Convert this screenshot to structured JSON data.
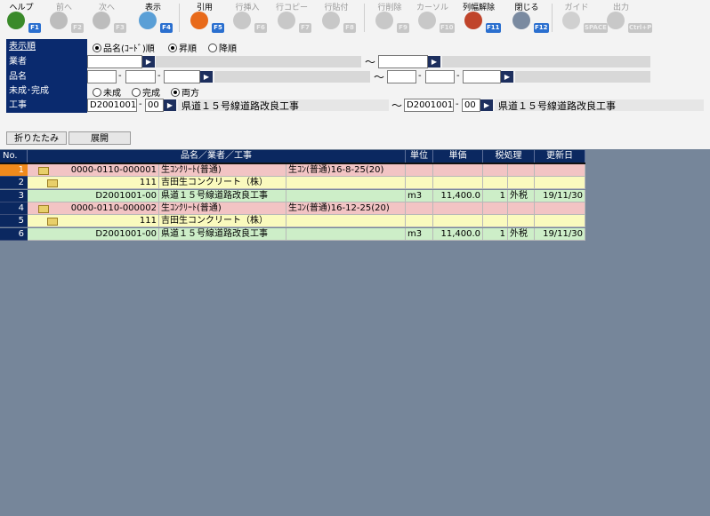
{
  "toolbar": [
    {
      "label": "ヘルプ",
      "fkey": "F1",
      "icon": "help-icon",
      "enabled": true,
      "color": "#3a8a2a"
    },
    {
      "label": "前へ",
      "fkey": "F2",
      "icon": "arrow-left-icon",
      "enabled": false,
      "color": "#bdbdbd"
    },
    {
      "label": "次へ",
      "fkey": "F3",
      "icon": "arrow-right-icon",
      "enabled": false,
      "color": "#bdbdbd"
    },
    {
      "label": "表示",
      "fkey": "F4",
      "icon": "magnifier-icon",
      "enabled": true,
      "color": "#5a9fd6"
    },
    {
      "label": "引用",
      "fkey": "F5",
      "icon": "quote-icon",
      "enabled": true,
      "color": "#e86a1a"
    },
    {
      "label": "行挿入",
      "fkey": "F6",
      "icon": "row-insert-icon",
      "enabled": false,
      "color": "#c8c8c8"
    },
    {
      "label": "行コピー",
      "fkey": "F7",
      "icon": "row-copy-icon",
      "enabled": false,
      "color": "#c8c8c8"
    },
    {
      "label": "行貼付",
      "fkey": "F8",
      "icon": "row-paste-icon",
      "enabled": false,
      "color": "#c8c8c8"
    },
    {
      "label": "行削除",
      "fkey": "F9",
      "icon": "row-delete-icon",
      "enabled": false,
      "color": "#c8c8c8"
    },
    {
      "label": "カーソル",
      "fkey": "F10",
      "icon": "cursor-icon",
      "enabled": false,
      "color": "#c8c8c8"
    },
    {
      "label": "列幅解除",
      "fkey": "F11",
      "icon": "column-width-reset-icon",
      "enabled": true,
      "color": "#c0442a"
    },
    {
      "label": "閉じる",
      "fkey": "F12",
      "icon": "close-door-icon",
      "enabled": true,
      "color": "#7a8aa0"
    },
    {
      "label": "ガイド",
      "fkey": "SPACE",
      "icon": "guide-bulb-icon",
      "enabled": false,
      "color": "#d0d0d0"
    },
    {
      "label": "出力",
      "fkey": "Ctrl+P",
      "icon": "printer-icon",
      "enabled": false,
      "color": "#c8c8c8"
    }
  ],
  "filters": {
    "sort": {
      "label": "表示順",
      "opt1": "品名(ｺｰﾄﾞ)順",
      "opt2": "昇順",
      "opt3": "降順"
    },
    "vendor": {
      "label": "業者",
      "tilde": "～"
    },
    "item": {
      "label": "品名",
      "dash": "-",
      "tilde": "～"
    },
    "status": {
      "label": "未成･完成",
      "opt1": "未成",
      "opt2": "完成",
      "opt3": "両方"
    },
    "project": {
      "label": "工事",
      "from_code": "D2001001",
      "from_sub": "00",
      "from_name": "県道１５号線道路改良工事",
      "to_code": "D2001001",
      "to_sub": "00",
      "to_name": "県道１５号線道路改良工事",
      "dash": "-",
      "tilde": "～"
    }
  },
  "actions": {
    "collapse": "折りたたみ",
    "expand": "展開"
  },
  "grid": {
    "headers": [
      "No.",
      "品名／業者／工事",
      "単位",
      "単価",
      "税処理",
      "更新日"
    ],
    "rows": [
      {
        "no": "1",
        "level": 0,
        "code": "0000-0110-000001",
        "name": "生ｺﾝｸﾘｰﾄ(普通)",
        "extra": "生ｺﾝ(普通)16-8-25(20)",
        "unit": "",
        "price": "",
        "tax_code": "",
        "tax": "",
        "date": "",
        "bg": "#f2c4c4",
        "selected": true
      },
      {
        "no": "2",
        "level": 1,
        "code": "111",
        "name": "吉田生コンクリート（株）",
        "extra": "",
        "unit": "",
        "price": "",
        "tax_code": "",
        "tax": "",
        "date": "",
        "bg": "#fafabe",
        "selected": false
      },
      {
        "no": "3",
        "level": 2,
        "code": "D2001001-00",
        "name": "県道１５号線道路改良工事",
        "extra": "",
        "unit": "m3",
        "price": "11,400.0",
        "tax_code": "1",
        "tax": "外税",
        "date": "19/11/30",
        "bg": "#cdeec8",
        "selected": false
      },
      {
        "no": "4",
        "level": 0,
        "code": "0000-0110-000002",
        "name": "生ｺﾝｸﾘｰﾄ(普通)",
        "extra": "生ｺﾝ(普通)16-12-25(20)",
        "unit": "",
        "price": "",
        "tax_code": "",
        "tax": "",
        "date": "",
        "bg": "#f2c4c4",
        "selected": false
      },
      {
        "no": "5",
        "level": 1,
        "code": "111",
        "name": "吉田生コンクリート（株）",
        "extra": "",
        "unit": "",
        "price": "",
        "tax_code": "",
        "tax": "",
        "date": "",
        "bg": "#fafabe",
        "selected": false
      },
      {
        "no": "6",
        "level": 2,
        "code": "D2001001-00",
        "name": "県道１５号線道路改良工事",
        "extra": "",
        "unit": "m3",
        "price": "11,400.0",
        "tax_code": "1",
        "tax": "外税",
        "date": "19/11/30",
        "bg": "#cdeec8",
        "selected": false
      }
    ]
  }
}
